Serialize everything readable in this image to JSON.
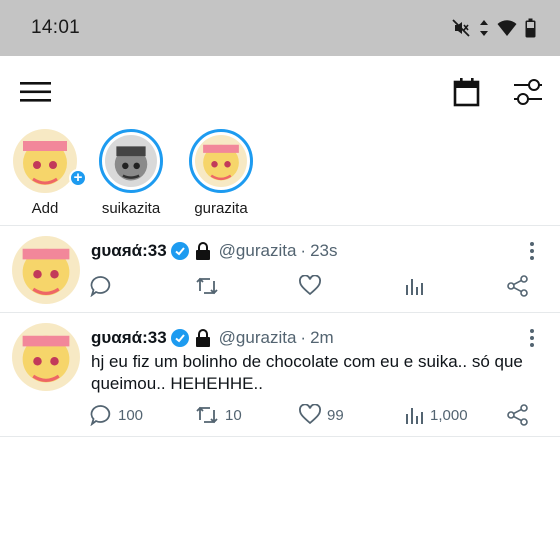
{
  "status_bar": {
    "time": "14:01",
    "icons": [
      "mute-icon",
      "data-arrows-icon",
      "wifi-icon",
      "battery-icon"
    ]
  },
  "topbar": {
    "icons": [
      "hamburger-menu-icon",
      "calendar-icon",
      "filter-sliders-icon"
    ]
  },
  "stories": [
    {
      "label": "Add",
      "badge": "+"
    },
    {
      "label": "suikazita"
    },
    {
      "label": "gurazita"
    }
  ],
  "posts": [
    {
      "display_name": "ɡυαяά:33",
      "handle": "@gurazita",
      "separator": "·",
      "time": "23s",
      "text": "",
      "stats": {
        "replies": "",
        "reposts": "",
        "likes": "",
        "views": ""
      }
    },
    {
      "display_name": "ɡυαяά:33",
      "handle": "@gurazita",
      "separator": "·",
      "time": "2m",
      "text": "hj eu fiz um bolinho de chocolate com eu e suika.. só que queimou.. HEHEHHE..",
      "stats": {
        "replies": "100",
        "reposts": "10",
        "likes": "99",
        "views": "1,000"
      }
    }
  ],
  "colors": {
    "accent": "#1d9bf0",
    "secondary_text": "#536471",
    "status_bar": "#c4c4c4"
  }
}
